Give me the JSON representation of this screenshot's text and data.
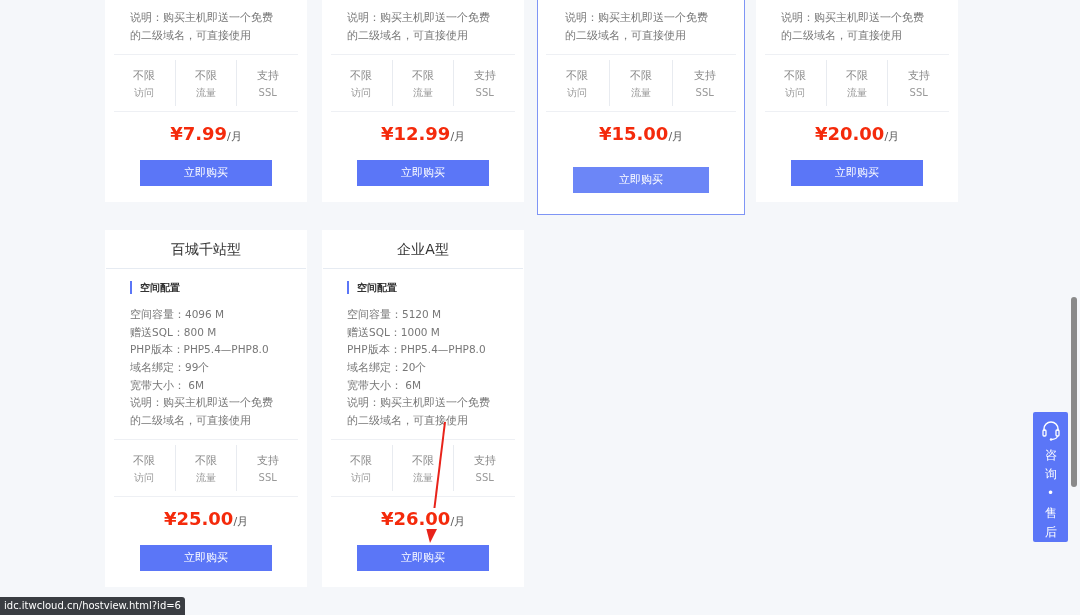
{
  "plans": [
    {
      "note": "说明：购买主机即送一个免费的二级域名，可直接使用",
      "stats": [
        {
          "value": "不限",
          "label": "访问"
        },
        {
          "value": "不限",
          "label": "流量"
        },
        {
          "value": "支持",
          "label": "SSL"
        }
      ],
      "price": "¥7.99",
      "unit": "/月",
      "button": "立即购买",
      "highlighted": false
    },
    {
      "note": "说明：购买主机即送一个免费的二级域名，可直接使用",
      "stats": [
        {
          "value": "不限",
          "label": "访问"
        },
        {
          "value": "不限",
          "label": "流量"
        },
        {
          "value": "支持",
          "label": "SSL"
        }
      ],
      "price": "¥12.99",
      "unit": "/月",
      "button": "立即购买",
      "highlighted": false
    },
    {
      "note": "说明：购买主机即送一个免费的二级域名，可直接使用",
      "stats": [
        {
          "value": "不限",
          "label": "访问"
        },
        {
          "value": "不限",
          "label": "流量"
        },
        {
          "value": "支持",
          "label": "SSL"
        }
      ],
      "price": "¥15.00",
      "unit": "/月",
      "button": "立即购买",
      "highlighted": true
    },
    {
      "note": "说明：购买主机即送一个免费的二级域名，可直接使用",
      "stats": [
        {
          "value": "不限",
          "label": "访问"
        },
        {
          "value": "不限",
          "label": "流量"
        },
        {
          "value": "支持",
          "label": "SSL"
        }
      ],
      "price": "¥20.00",
      "unit": "/月",
      "button": "立即购买",
      "highlighted": false
    },
    {
      "title": "百城千站型",
      "section": "空间配置",
      "specs": [
        "空间容量：4096 M",
        "赠送SQL：800 M",
        "PHP版本：PHP5.4—PHP8.0",
        "域名绑定：99个",
        "宽带大小：  6M"
      ],
      "note": "说明：购买主机即送一个免费的二级域名，可直接使用",
      "stats": [
        {
          "value": "不限",
          "label": "访问"
        },
        {
          "value": "不限",
          "label": "流量"
        },
        {
          "value": "支持",
          "label": "SSL"
        }
      ],
      "price": "¥25.00",
      "unit": "/月",
      "button": "立即购买",
      "highlighted": false
    },
    {
      "title": "企业A型",
      "section": "空间配置",
      "specs": [
        "空间容量：5120 M",
        "赠送SQL：1000 M",
        "PHP版本：PHP5.4—PHP8.0",
        "域名绑定：20个",
        "宽带大小：  6M"
      ],
      "note": "说明：购买主机即送一个免费的二级域名，可直接使用",
      "stats": [
        {
          "value": "不限",
          "label": "访问"
        },
        {
          "value": "不限",
          "label": "流量"
        },
        {
          "value": "支持",
          "label": "SSL"
        }
      ],
      "price": "¥26.00",
      "unit": "/月",
      "button": "立即购买",
      "highlighted": false
    }
  ],
  "side_widget": {
    "label": "咨询•售后"
  },
  "status_url": "idc.itwcloud.cn/hostview.html?id=6"
}
